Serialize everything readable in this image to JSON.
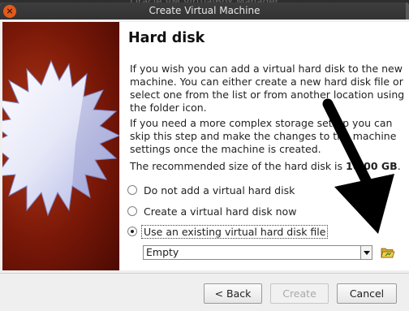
{
  "background_window": {
    "title": "Oracle VM VirtualBox Manager"
  },
  "dialog": {
    "title": "Create Virtual Machine",
    "close_glyph": "×"
  },
  "page": {
    "heading": "Hard disk",
    "para1": "If you wish you can add a virtual hard disk to the new machine. You can either create a new hard disk file or select one from the list or from another location using the folder icon.",
    "para2": "If you need a more complex storage set-up you can skip this step and make the changes to the machine settings once the machine is created.",
    "para3_prefix": "The recommended size of the hard disk is ",
    "para3_value": "10.00 GB",
    "para3_suffix": "."
  },
  "options": {
    "no_disk": {
      "label": "Do not add a virtual hard disk",
      "selected": false
    },
    "create_disk": {
      "label": "Create a virtual hard disk now",
      "selected": false
    },
    "existing_disk": {
      "label": "Use an existing virtual hard disk file",
      "selected": true
    }
  },
  "disk_select": {
    "value": "Empty"
  },
  "buttons": {
    "back": "< Back",
    "create": "Create",
    "cancel": "Cancel"
  },
  "icons": {
    "folder": "folder-open-icon",
    "arrow": "annotation-arrow-icon"
  },
  "colors": {
    "art_red": "#8a1e0a",
    "titlebar": "#3a3a3a",
    "close": "#e25a1c",
    "folder": "#e8c13a"
  }
}
